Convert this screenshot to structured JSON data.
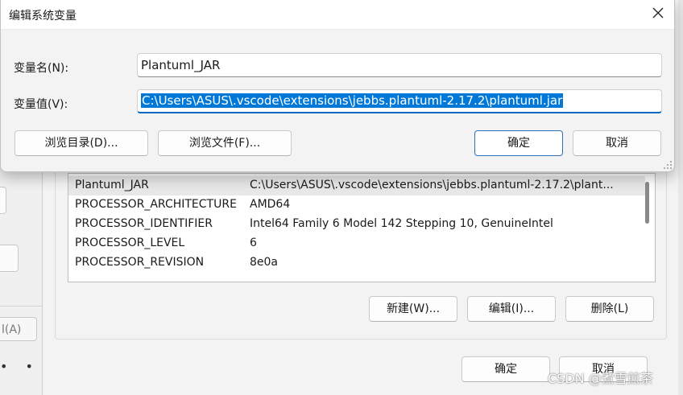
{
  "dialog": {
    "title": "编辑系统变量",
    "name_label": "变量名(N):",
    "name_value": "Plantuml_JAR",
    "value_label": "变量值(V):",
    "value_value": "C:\\Users\\ASUS\\.vscode\\extensions\\jebbs.plantuml-2.17.2\\plantuml.jar",
    "browse_dir_button": "浏览目录(D)...",
    "browse_file_button": "浏览文件(F)...",
    "ok_button": "确定",
    "cancel_button": "取消"
  },
  "background": {
    "left_button_partial": "l(A)",
    "variables": [
      {
        "name": "Plantuml_JAR",
        "value": "C:\\Users\\ASUS\\.vscode\\extensions\\jebbs.plantuml-2.17.2\\plant..."
      },
      {
        "name": "PROCESSOR_ARCHITECTURE",
        "value": "AMD64"
      },
      {
        "name": "PROCESSOR_IDENTIFIER",
        "value": "Intel64 Family 6 Model 142 Stepping 10, GenuineIntel"
      },
      {
        "name": "PROCESSOR_LEVEL",
        "value": "6"
      },
      {
        "name": "PROCESSOR_REVISION",
        "value": "8e0a"
      }
    ],
    "new_button": "新建(W)...",
    "edit_button": "编辑(I)...",
    "delete_button": "删除(L)",
    "ok_button": "确定",
    "cancel_button": "取消"
  },
  "watermark": "CSDN @煮雪煎茶",
  "colors": {
    "accent": "#0067c0",
    "selection": "#0078d7",
    "dialog_bg": "#f3f3f3"
  }
}
